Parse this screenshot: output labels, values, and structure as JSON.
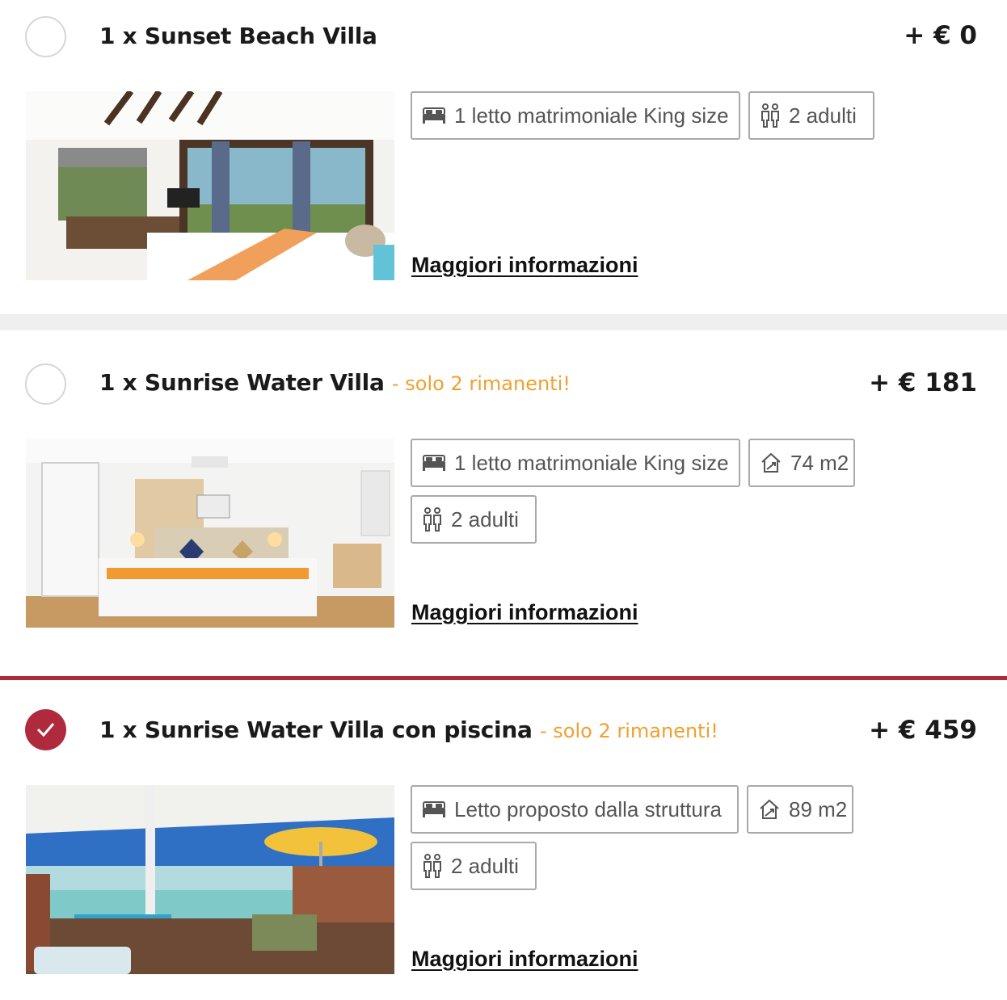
{
  "colors": {
    "accent": "#b02a3e",
    "availability": "#f0a030"
  },
  "icons": {
    "bed": "bed-icon",
    "guests": "guests-icon",
    "area": "area-icon",
    "check": "checkmark-icon"
  },
  "rooms": [
    {
      "title": "1 x Sunset Beach Villa",
      "availability": "",
      "price": "+ € 0",
      "selected": false,
      "features": [
        "1 letto matrimoniale King size",
        "2 adulti"
      ],
      "more_label": "Maggiori informazioni"
    },
    {
      "title": "1 x Sunrise Water Villa",
      "availability": "- solo 2 rimanenti!",
      "price": "+ € 181",
      "selected": false,
      "features": [
        "1 letto matrimoniale King size",
        "74 m2",
        "2 adulti"
      ],
      "more_label": "Maggiori informazioni"
    },
    {
      "title": "1 x Sunrise Water Villa con piscina",
      "availability": "- solo 2 rimanenti!",
      "price": "+ € 459",
      "selected": true,
      "features": [
        "Letto proposto dalla struttura",
        "89 m2",
        "2 adulti"
      ],
      "more_label": "Maggiori informazioni"
    }
  ]
}
